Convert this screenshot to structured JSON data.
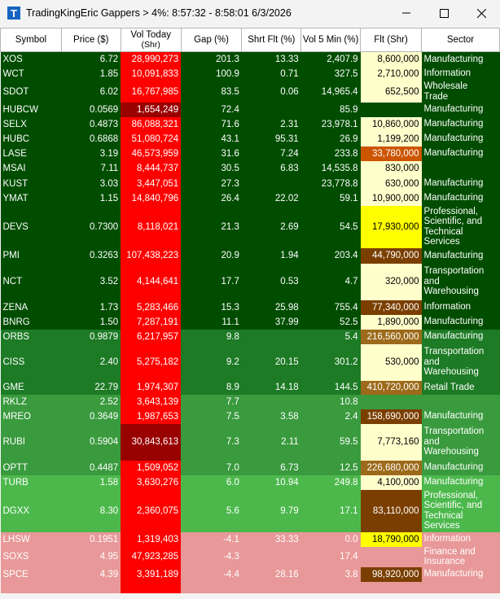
{
  "window": {
    "icon_letter": "T",
    "title": "TradingKingEric Gappers > 4%:  8:57:32 - 8:58:01   6/3/2026"
  },
  "columns": [
    {
      "label": "Symbol"
    },
    {
      "label": "Price ($)"
    },
    {
      "label": "Vol Today",
      "label2": "(Shr)"
    },
    {
      "label": "Gap (%)"
    },
    {
      "label": "Shrt Flt (%)"
    },
    {
      "label": "Vol 5 Min (%)"
    },
    {
      "label": "Flt (Shr)"
    },
    {
      "label": "Sector"
    }
  ],
  "rows": [
    {
      "symbol": "XOS",
      "price": "6.72",
      "vol_today": "28,990,273",
      "gap": "201.3",
      "short_float": "13.33",
      "vol5": "2,407.9",
      "float": "8,600,000",
      "sector": [
        "Manufacturing"
      ]
    },
    {
      "symbol": "WCT",
      "price": "1.85",
      "vol_today": "10,091,833",
      "gap": "100.9",
      "short_float": "0.71",
      "vol5": "327.5",
      "float": "2,710,000",
      "sector": [
        "Information"
      ]
    },
    {
      "symbol": "SDOT",
      "price": "6.02",
      "vol_today": "16,767,985",
      "gap": "83.5",
      "short_float": "0.06",
      "vol5": "14,965.4",
      "float": "652,500",
      "sector": [
        "Wholesale",
        "Trade"
      ]
    },
    {
      "symbol": "HUBCW",
      "price": "0.0569",
      "vol_today": "1,654,249",
      "gap": "72.4",
      "short_float": "",
      "vol5": "85.9",
      "float": "",
      "sector": [
        "Manufacturing"
      ]
    },
    {
      "symbol": "SELX",
      "price": "0.4873",
      "vol_today": "86,088,321",
      "gap": "71.6",
      "short_float": "2.31",
      "vol5": "23,978.1",
      "float": "10,860,000",
      "sector": [
        "Manufacturing"
      ]
    },
    {
      "symbol": "HUBC",
      "price": "0.6868",
      "vol_today": "51,080,724",
      "gap": "43.1",
      "short_float": "95.31",
      "vol5": "26.9",
      "float": "1,199,200",
      "sector": [
        "Manufacturing"
      ]
    },
    {
      "symbol": "LASE",
      "price": "3.19",
      "vol_today": "46,573,959",
      "gap": "31.6",
      "short_float": "7.24",
      "vol5": "233.8",
      "float": "33,780,000",
      "sector": [
        "Manufacturing"
      ]
    },
    {
      "symbol": "MSAI",
      "price": "7.11",
      "vol_today": "8,444,737",
      "gap": "30.5",
      "short_float": "6.83",
      "vol5": "14,535.8",
      "float": "830,000",
      "sector": []
    },
    {
      "symbol": "KUST",
      "price": "3.03",
      "vol_today": "3,447,051",
      "gap": "27.3",
      "short_float": "",
      "vol5": "23,778.8",
      "float": "630,000",
      "sector": [
        "Manufacturing"
      ]
    },
    {
      "symbol": "YMAT",
      "price": "1.15",
      "vol_today": "14,840,796",
      "gap": "26.4",
      "short_float": "22.02",
      "vol5": "59.1",
      "float": "10,900,000",
      "sector": [
        "Manufacturing"
      ]
    },
    {
      "symbol": "DEVS",
      "price": "0.7300",
      "vol_today": "8,118,021",
      "gap": "21.3",
      "short_float": "2.69",
      "vol5": "54.5",
      "float": "17,930,000",
      "sector": [
        "Professional,",
        "Scientific, and",
        "Technical",
        "Services"
      ]
    },
    {
      "symbol": "PMI",
      "price": "0.3263",
      "vol_today": "107,438,223",
      "gap": "20.9",
      "short_float": "1.94",
      "vol5": "203.4",
      "float": "44,790,000",
      "sector": [
        "Manufacturing"
      ]
    },
    {
      "symbol": "NCT",
      "price": "3.52",
      "vol_today": "4,144,641",
      "gap": "17.7",
      "short_float": "0.53",
      "vol5": "4.7",
      "float": "320,000",
      "sector": [
        "Transportation",
        "and",
        "Warehousing"
      ]
    },
    {
      "symbol": "ZENA",
      "price": "1.73",
      "vol_today": "5,283,466",
      "gap": "15.3",
      "short_float": "25.98",
      "vol5": "755.4",
      "float": "77,340,000",
      "sector": [
        "Information"
      ]
    },
    {
      "symbol": "BNRG",
      "price": "1.50",
      "vol_today": "7,287,191",
      "gap": "11.1",
      "short_float": "37.99",
      "vol5": "52.5",
      "float": "1,890,000",
      "sector": [
        "Manufacturing"
      ]
    },
    {
      "symbol": "ORBS",
      "price": "0.9879",
      "vol_today": "6,217,957",
      "gap": "9.8",
      "short_float": "",
      "vol5": "5.4",
      "float": "216,560,000",
      "sector": [
        "Manufacturing"
      ]
    },
    {
      "symbol": "CISS",
      "price": "2.40",
      "vol_today": "5,275,182",
      "gap": "9.2",
      "short_float": "20.15",
      "vol5": "301.2",
      "float": "530,000",
      "sector": [
        "Transportation",
        "and",
        "Warehousing"
      ]
    },
    {
      "symbol": "GME",
      "price": "22.79",
      "vol_today": "1,974,307",
      "gap": "8.9",
      "short_float": "14.18",
      "vol5": "144.5",
      "float": "410,720,000",
      "sector": [
        "Retail Trade"
      ]
    },
    {
      "symbol": "RKLZ",
      "price": "2.52",
      "vol_today": "3,643,139",
      "gap": "7.7",
      "short_float": "",
      "vol5": "10.8",
      "float": "",
      "sector": []
    },
    {
      "symbol": "MREO",
      "price": "0.3649",
      "vol_today": "1,987,653",
      "gap": "7.5",
      "short_float": "3.58",
      "vol5": "2.4",
      "float": "158,690,000",
      "sector": [
        "Manufacturing"
      ]
    },
    {
      "symbol": "RUBI",
      "price": "0.5904",
      "vol_today": "30,843,613",
      "gap": "7.3",
      "short_float": "2.11",
      "vol5": "59.5",
      "float": "7,773,160",
      "sector": [
        "Transportation",
        "and",
        "Warehousing"
      ]
    },
    {
      "symbol": "OPTT",
      "price": "0.4487",
      "vol_today": "1,509,052",
      "gap": "7.0",
      "short_float": "6.73",
      "vol5": "12.5",
      "float": "226,680,000",
      "sector": [
        "Manufacturing"
      ]
    },
    {
      "symbol": "TURB",
      "price": "1.58",
      "vol_today": "3,630,276",
      "gap": "6.0",
      "short_float": "10.94",
      "vol5": "249.8",
      "float": "4,100,000",
      "sector": [
        "Manufacturing"
      ]
    },
    {
      "symbol": "DGXX",
      "price": "8.30",
      "vol_today": "2,360,075",
      "gap": "5.6",
      "short_float": "9.79",
      "vol5": "17.1",
      "float": "83,110,000",
      "sector": [
        "Professional,",
        "Scientific, and",
        "Technical",
        "Services"
      ]
    },
    {
      "symbol": "LHSW",
      "price": "0.1951",
      "vol_today": "1,319,403",
      "gap": "-4.1",
      "short_float": "33.33",
      "vol5": "0.0",
      "float": "18,790,000",
      "sector": [
        "Information"
      ]
    },
    {
      "symbol": "SOXS",
      "price": "4.95",
      "vol_today": "47,923,285",
      "gap": "-4.3",
      "short_float": "",
      "vol5": "17.4",
      "float": "",
      "sector": [
        "Finance and",
        "Insurance"
      ]
    },
    {
      "symbol": "SPCE",
      "price": "4.39",
      "vol_today": "3,391,189",
      "gap": "-4.4",
      "short_float": "28.16",
      "vol5": "3.8",
      "float": "98,920,000",
      "sector": [
        "Manufacturing"
      ]
    },
    {
      "symbol": "",
      "price": "",
      "vol_today": "",
      "gap": "",
      "short_float": "",
      "vol5": "",
      "float": "",
      "sector": []
    }
  ],
  "colors": {
    "row_dark_green": "#004d00",
    "row_mid_green": "#1d7a25",
    "row_light_green": "#3a9a3e",
    "row_bright_green": "#4cb84c",
    "row_pink": "#e89898",
    "vol_red": "#ff0000",
    "vol_dark_red": "#990000",
    "float_pale_yellow": "#ffffcc",
    "float_yellow": "#ffff00",
    "float_orange": "#cc5500",
    "float_brown": "#7a3f00",
    "float_dark_brown": "#5c2a00",
    "float_olive": "#9c6a1a"
  }
}
